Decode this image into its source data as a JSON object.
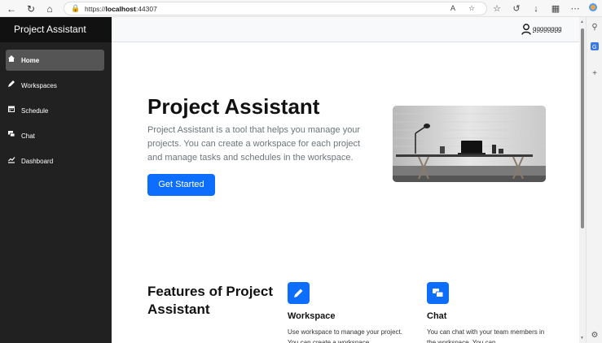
{
  "browser": {
    "url_prefix": "https://",
    "url_host": "localhost",
    "url_port": ":44307"
  },
  "sidebar": {
    "brand": "Project Assistant",
    "items": [
      {
        "label": "Home",
        "icon": "home-icon",
        "active": true
      },
      {
        "label": "Workspaces",
        "icon": "pencil-icon",
        "active": false
      },
      {
        "label": "Schedule",
        "icon": "calendar-icon",
        "active": false
      },
      {
        "label": "Chat",
        "icon": "chat-icon",
        "active": false
      },
      {
        "label": "Dashboard",
        "icon": "chart-icon",
        "active": false
      }
    ]
  },
  "header": {
    "username": "qqqqqqqq"
  },
  "hero": {
    "title": "Project Assistant",
    "description": "Project Assistant is a tool that helps you manage your projects. You can create a workspace for each project and manage tasks and schedules in the workspace.",
    "cta_label": "Get Started"
  },
  "features": {
    "title": "Features of Project Assistant",
    "items": [
      {
        "title": "Workspace",
        "text": "Use workspace to manage your project. You can create a workspace",
        "icon": "pencil-icon"
      },
      {
        "title": "Chat",
        "text": "You can chat with your team members in the workspace. You can",
        "icon": "chat-bubbles-icon"
      }
    ]
  },
  "colors": {
    "primary": "#0d6efd",
    "sidebar_bg": "#212121",
    "brand_bg": "#111111",
    "active_item_bg": "#555555"
  }
}
